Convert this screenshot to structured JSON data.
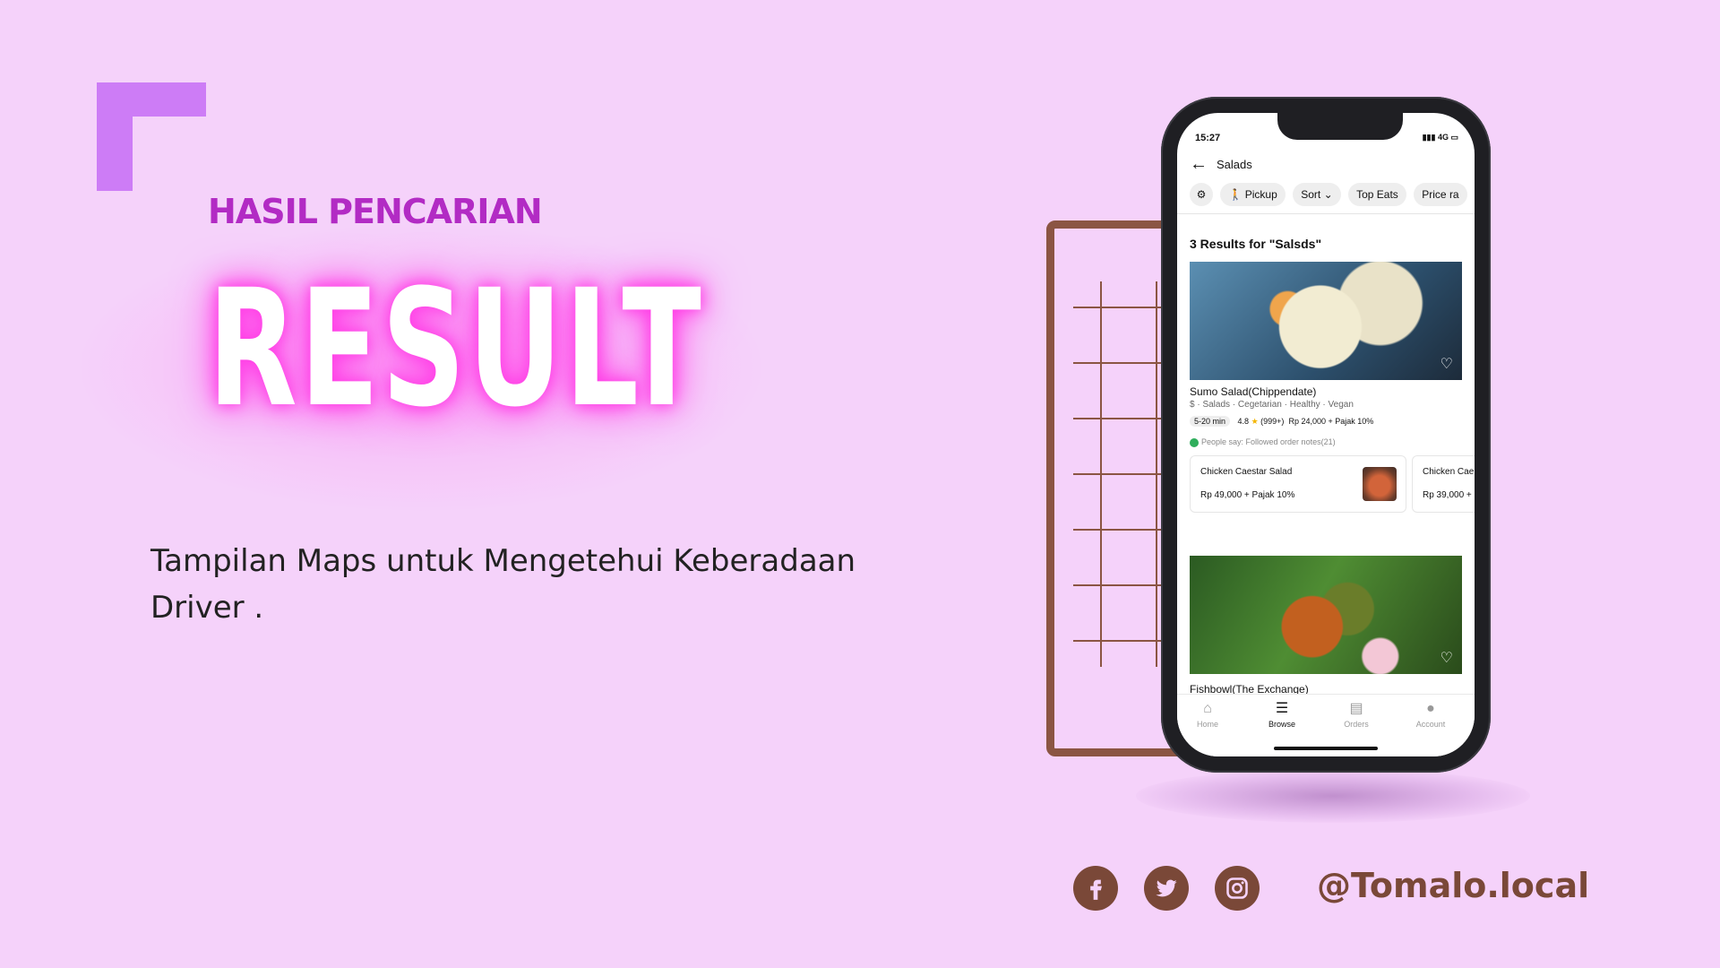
{
  "slide": {
    "subtitle": "HASIL PENCARIAN",
    "headline": "RESULT",
    "description": "Tampilan Maps untuk Mengetehui Keberadaan Driver .",
    "handle": "@Tomalo.local",
    "colors": {
      "background": "#f5d2fa",
      "accent": "#cd7cf6",
      "subtitle": "#b22bc4",
      "glow": "#ff3ee6",
      "brown": "#7a4838"
    }
  },
  "social": [
    "facebook-icon",
    "twitter-icon",
    "instagram-icon"
  ],
  "phone": {
    "status": {
      "time": "15:27",
      "network": "4G"
    },
    "nav": {
      "title": "Salads"
    },
    "chips": [
      "Pickup",
      "Sort",
      "Top Eats",
      "Price ra"
    ],
    "results_title": "3 Results for \"Salsds\"",
    "restaurant1": {
      "name": "Sumo Salad(Chippendate)",
      "tags": "$ · Salads · Cegetarian · Healthy · Vegan",
      "time": "5-20 min",
      "rating": "4.8",
      "reviews": "(999+)",
      "price": "Rp 24,000 + Pajak 10%",
      "note": "People say: Followed order notes(21)",
      "dishes": [
        {
          "name": "Chicken Caestar Salad",
          "price": "Rp 49,000 + Pajak 10%"
        },
        {
          "name": "Chicken Cae",
          "price": "Rp 39,000 +"
        }
      ]
    },
    "restaurant2": {
      "name": "Fishbowl(The Exchange)"
    },
    "tabs": [
      {
        "label": "Home",
        "icon": "home-icon"
      },
      {
        "label": "Browse",
        "icon": "browse-icon"
      },
      {
        "label": "Orders",
        "icon": "orders-icon"
      },
      {
        "label": "Account",
        "icon": "account-icon"
      }
    ]
  }
}
